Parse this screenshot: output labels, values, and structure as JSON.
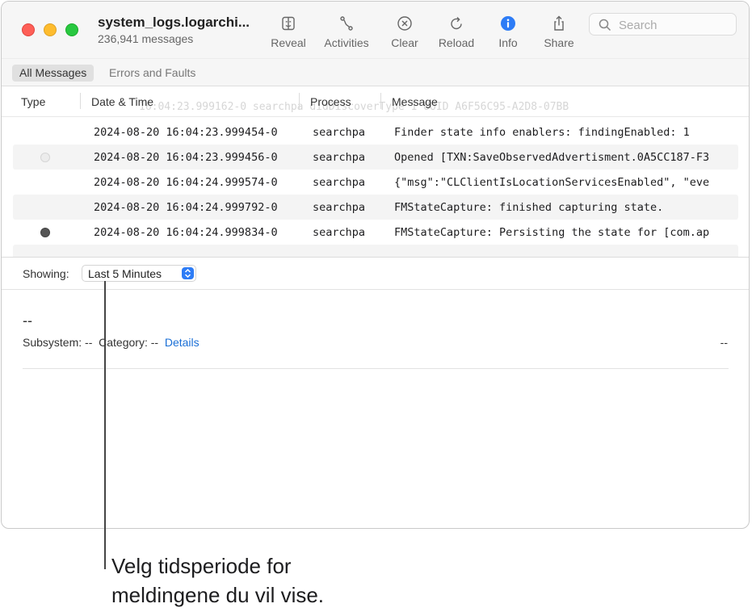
{
  "window": {
    "title": "system_logs.logarchi...",
    "subtitle": "236,941 messages"
  },
  "toolbar": {
    "items": [
      {
        "label": "Reveal",
        "icon": "reveal-icon"
      },
      {
        "label": "Activities",
        "icon": "activities-icon"
      },
      {
        "label": "Clear",
        "icon": "clear-icon"
      },
      {
        "label": "Reload",
        "icon": "reload-icon"
      },
      {
        "label": "Info",
        "icon": "info-icon"
      },
      {
        "label": "Share",
        "icon": "share-icon"
      }
    ],
    "search_placeholder": "Search"
  },
  "filters": {
    "all_messages": "All Messages",
    "errors_faults": "Errors and Faults"
  },
  "columns": {
    "type": "Type",
    "date_time": "Date & Time",
    "process": "Process",
    "message": "Message"
  },
  "ghost_row": "16:04:23.999162-0 searchpa  didDiscoverType 1 UUID A6F56C95-A2D8-07BB",
  "rows": [
    {
      "type": "none",
      "date": "2024-08-20 16:04:23.999454-0",
      "process": "searchpa",
      "message": "Finder state info enablers:   findingEnabled: 1"
    },
    {
      "type": "faint",
      "date": "2024-08-20 16:04:23.999456-0",
      "process": "searchpa",
      "message": "Opened [TXN:SaveObservedAdvertisment.0A5CC187-F3"
    },
    {
      "type": "none",
      "date": "2024-08-20 16:04:24.999574-0",
      "process": "searchpa",
      "message": "{\"msg\":\"CLClientIsLocationServicesEnabled\", \"eve"
    },
    {
      "type": "none",
      "date": "2024-08-20 16:04:24.999792-0",
      "process": "searchpa",
      "message": "FMStateCapture: finished capturing state."
    },
    {
      "type": "dark",
      "date": "2024-08-20 16:04:24.999834-0",
      "process": "searchpa",
      "message": "FMStateCapture: Persisting the state for [com.ap"
    }
  ],
  "showing": {
    "label": "Showing:",
    "selected": "Last 5 Minutes"
  },
  "detail": {
    "title": "--",
    "subsystem_label": "Subsystem: --",
    "category_label": "Category: --",
    "details_link": "Details",
    "right_value": "--"
  },
  "callout": {
    "line1": "Velg tidsperiode for",
    "line2": "meldingene du vil vise."
  },
  "colors": {
    "accent": "#2d7cf6",
    "close": "#fe5f57",
    "minimize": "#febc2e",
    "maximize": "#28c840",
    "link": "#1a6fd6"
  }
}
